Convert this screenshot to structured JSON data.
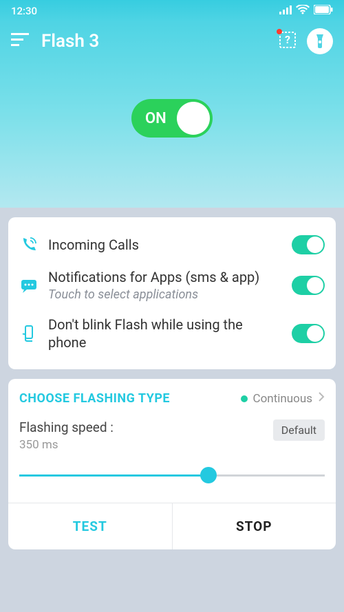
{
  "status": {
    "time": "12:30"
  },
  "header": {
    "title": "Flash 3",
    "main_toggle": {
      "label": "ON",
      "on": true
    }
  },
  "options": [
    {
      "title": "Incoming Calls",
      "sub": "",
      "on": true
    },
    {
      "title": "Notifications for Apps (sms & app)",
      "sub": "Touch to select applications",
      "on": true
    },
    {
      "title": "Don't blink Flash while using the phone",
      "sub": "",
      "on": true
    }
  ],
  "flash": {
    "section_title": "CHOOSE FLASHING TYPE",
    "type_value": "Continuous",
    "speed_label": "Flashing speed :",
    "speed_value": "350 ms",
    "default_label": "Default",
    "test_label": "TEST",
    "stop_label": "STOP"
  }
}
